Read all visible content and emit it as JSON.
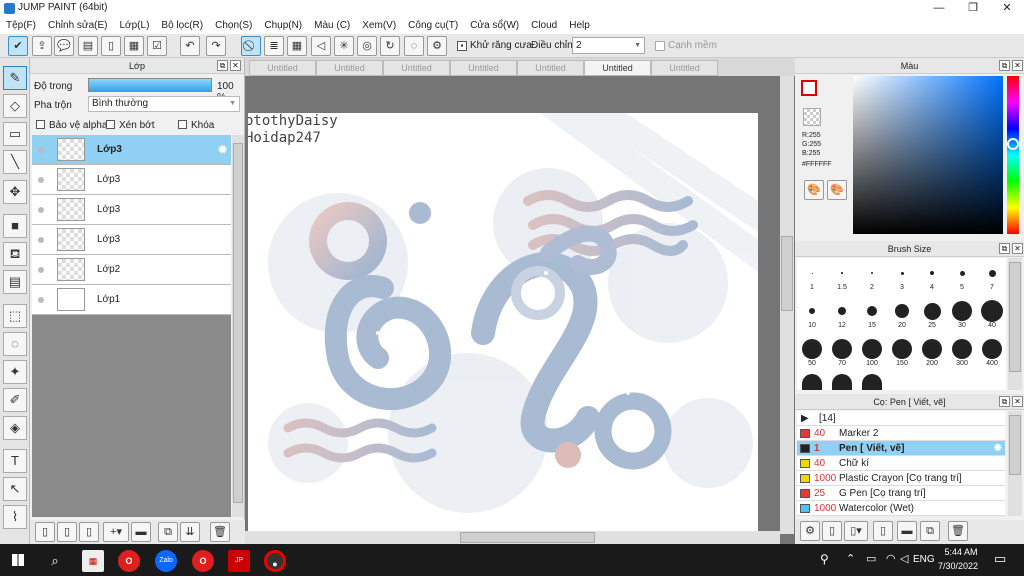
{
  "window": {
    "title": "JUMP PAINT (64bit)"
  },
  "menu": [
    "Tệp(F)",
    "Chỉnh sửa(E)",
    "Lớp(L)",
    "Bộ lọc(R)",
    "Chọn(S)",
    "Chụp(N)",
    "Màu (C)",
    "Xem(V)",
    "Công cụ(T)",
    "Cửa sổ(W)",
    "Cloud",
    "Help"
  ],
  "toolbar": {
    "antialias_label": "Khử răng cưa",
    "adjust_label": "Điều chỉnh",
    "adjust_value": "2",
    "sharp_label": "Cạnh mềm"
  },
  "layers": {
    "title": "Lớp",
    "opacity_label": "Độ trong",
    "opacity_value": "100 %",
    "opacity_fraction": 1.0,
    "blend_label": "Pha trộn",
    "blend_value": "Bình thường",
    "protect_alpha": "Bảo vệ alpha",
    "clip": "Xén bớt",
    "lock": "Khóa",
    "items": [
      {
        "name": "Lớp3"
      },
      {
        "name": "Lớp3"
      },
      {
        "name": "Lớp3"
      },
      {
        "name": "Lớp3"
      },
      {
        "name": "Lớp2"
      },
      {
        "name": "Lớp1"
      }
    ]
  },
  "tabs": [
    "Untitled",
    "Untitled",
    "Untitled",
    "Untitled",
    "Untitled",
    "Untitled",
    "Untitled"
  ],
  "canvas": {
    "watermark1": "otothyDaisy",
    "watermark2": "Hoidap247"
  },
  "color": {
    "title": "Màu",
    "r": "R:255",
    "g": "G:255",
    "b": "B:255",
    "hex": "#FFFFFF"
  },
  "brushsize": {
    "title": "Brush Size",
    "row1": [
      "1",
      "1.5",
      "2",
      "3",
      "4",
      "5",
      "7"
    ],
    "row2": [
      "10",
      "12",
      "15",
      "20",
      "25",
      "30",
      "40"
    ],
    "row3": [
      "50",
      "70",
      "100",
      "150",
      "200",
      "300",
      "400"
    ]
  },
  "brushlist": {
    "title": "Cọ: Pen [ Viết, vẽ]",
    "group": "[14]",
    "items": [
      {
        "size": "40",
        "name": "Marker 2",
        "color": "#e53935"
      },
      {
        "size": "1",
        "name": "Pen [ Viết, vẽ]",
        "color": "#222222"
      },
      {
        "size": "40",
        "name": "Chữ kí",
        "color": "#f2d600"
      },
      {
        "size": "1000",
        "name": "Plastic Crayon [Cọ trang trí]",
        "color": "#f2d600"
      },
      {
        "size": "25",
        "name": "G Pen [Cọ trang trí]",
        "color": "#e53935"
      },
      {
        "size": "1000",
        "name": "Watercolor (Wet)",
        "color": "#4fc3f7"
      }
    ]
  },
  "taskbar": {
    "lang": "ENG",
    "time": "5:44 AM",
    "date": "7/30/2022"
  }
}
